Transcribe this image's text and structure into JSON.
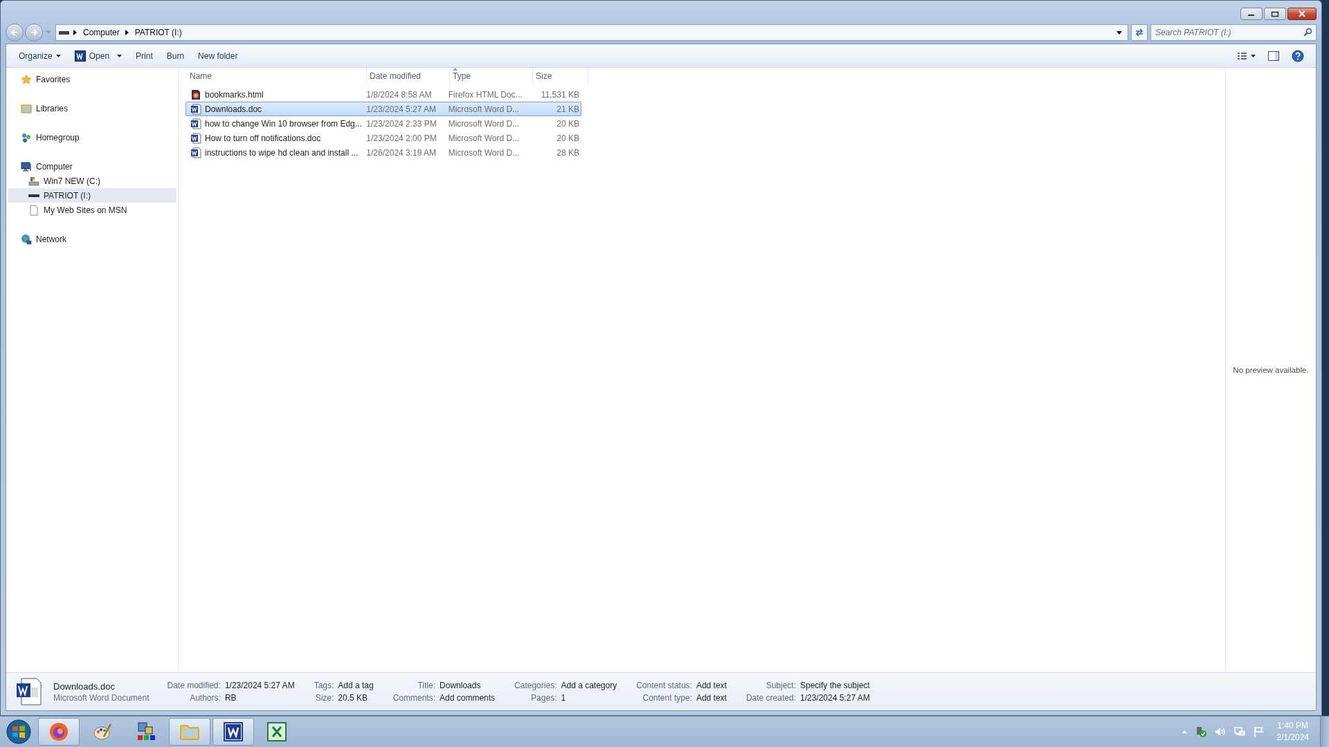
{
  "nav": {
    "path": [
      "Computer",
      "PATRIOT (I:)"
    ],
    "search": {
      "placeholder": "Search PATRIOT (I:)"
    }
  },
  "toolbar": [
    {
      "label": "Organize",
      "kind": "menu"
    },
    {
      "label": "Open",
      "kind": "open"
    },
    {
      "label": "Print",
      "kind": "plain"
    },
    {
      "label": "Burn",
      "kind": "plain"
    },
    {
      "label": "New folder",
      "kind": "plain"
    }
  ],
  "sidebar": {
    "items": [
      {
        "label": "Favorites",
        "kind": "star",
        "selected": false
      },
      {
        "label": "Libraries",
        "kind": "library",
        "selected": false
      },
      {
        "label": "Homegroup",
        "kind": "homegroup",
        "selected": false
      },
      {
        "label": "Computer",
        "kind": "computer",
        "selected": false,
        "children": [
          {
            "label": "Win7 NEW (C:)",
            "kind": "windrive",
            "selected": false
          },
          {
            "label": "PATRIOT (I:)",
            "kind": "usb",
            "selected": true
          },
          {
            "label": "My Web Sites on MSN",
            "kind": "page",
            "selected": false
          }
        ]
      },
      {
        "label": "Network",
        "kind": "network",
        "selected": false
      }
    ]
  },
  "files": {
    "columns": [
      "Name",
      "Date modified",
      "Type",
      "Size"
    ],
    "rows": [
      {
        "name": "bookmarks.html",
        "kind": "html",
        "date": "1/8/2024 8:58 AM",
        "type": "Firefox HTML Doc...",
        "size": "11,531 KB",
        "selected": false
      },
      {
        "name": "Downloads.doc",
        "kind": "doc",
        "date": "1/23/2024 5:27 AM",
        "type": "Microsoft Word D...",
        "size": "21 KB",
        "selected": true
      },
      {
        "name": "how to change Win 10 browser from Edg...",
        "kind": "doc",
        "date": "1/23/2024 2:33 PM",
        "type": "Microsoft Word D...",
        "size": "20 KB",
        "selected": false
      },
      {
        "name": "How to turn off notifications.doc",
        "kind": "doc",
        "date": "1/23/2024 2:00 PM",
        "type": "Microsoft Word D...",
        "size": "20 KB",
        "selected": false
      },
      {
        "name": "instructions to wipe hd clean and install ...",
        "kind": "doc",
        "date": "1/26/2024 3:19 AM",
        "type": "Microsoft Word D...",
        "size": "28 KB",
        "selected": false
      }
    ]
  },
  "preview": "No preview available.",
  "details": {
    "name": "Downloads.doc",
    "type": "Microsoft Word Document",
    "groups": [
      [
        {
          "label": "Date modified:",
          "value": "1/23/2024 5:27 AM"
        },
        {
          "label": "Authors:",
          "value": "RB"
        }
      ],
      [
        {
          "label": "Tags:",
          "value": "Add a tag"
        },
        {
          "label": "Size:",
          "value": "20.5 KB"
        }
      ],
      [
        {
          "label": "Title:",
          "value": "Downloads"
        },
        {
          "label": "Comments:",
          "value": "Add comments"
        }
      ],
      [
        {
          "label": "Categories:",
          "value": "Add a category"
        },
        {
          "label": "Pages:",
          "value": "1"
        }
      ],
      [
        {
          "label": "Content status:",
          "value": "Add text"
        },
        {
          "label": "Content type:",
          "value": "Add text"
        }
      ],
      [
        {
          "label": "Subject:",
          "value": "Specify the subject"
        },
        {
          "label": "Date created:",
          "value": "1/23/2024 5:27 AM"
        }
      ]
    ]
  },
  "taskbar": {
    "apps": [
      {
        "kind": "firefox",
        "running": true
      },
      {
        "kind": "paint",
        "running": false
      },
      {
        "kind": "tiles",
        "running": false
      },
      {
        "kind": "explorer",
        "running": true
      },
      {
        "kind": "word",
        "running": true
      },
      {
        "kind": "excel",
        "running": false
      }
    ],
    "clock": {
      "time": "1:40 PM",
      "date": "2/1/2024"
    }
  }
}
